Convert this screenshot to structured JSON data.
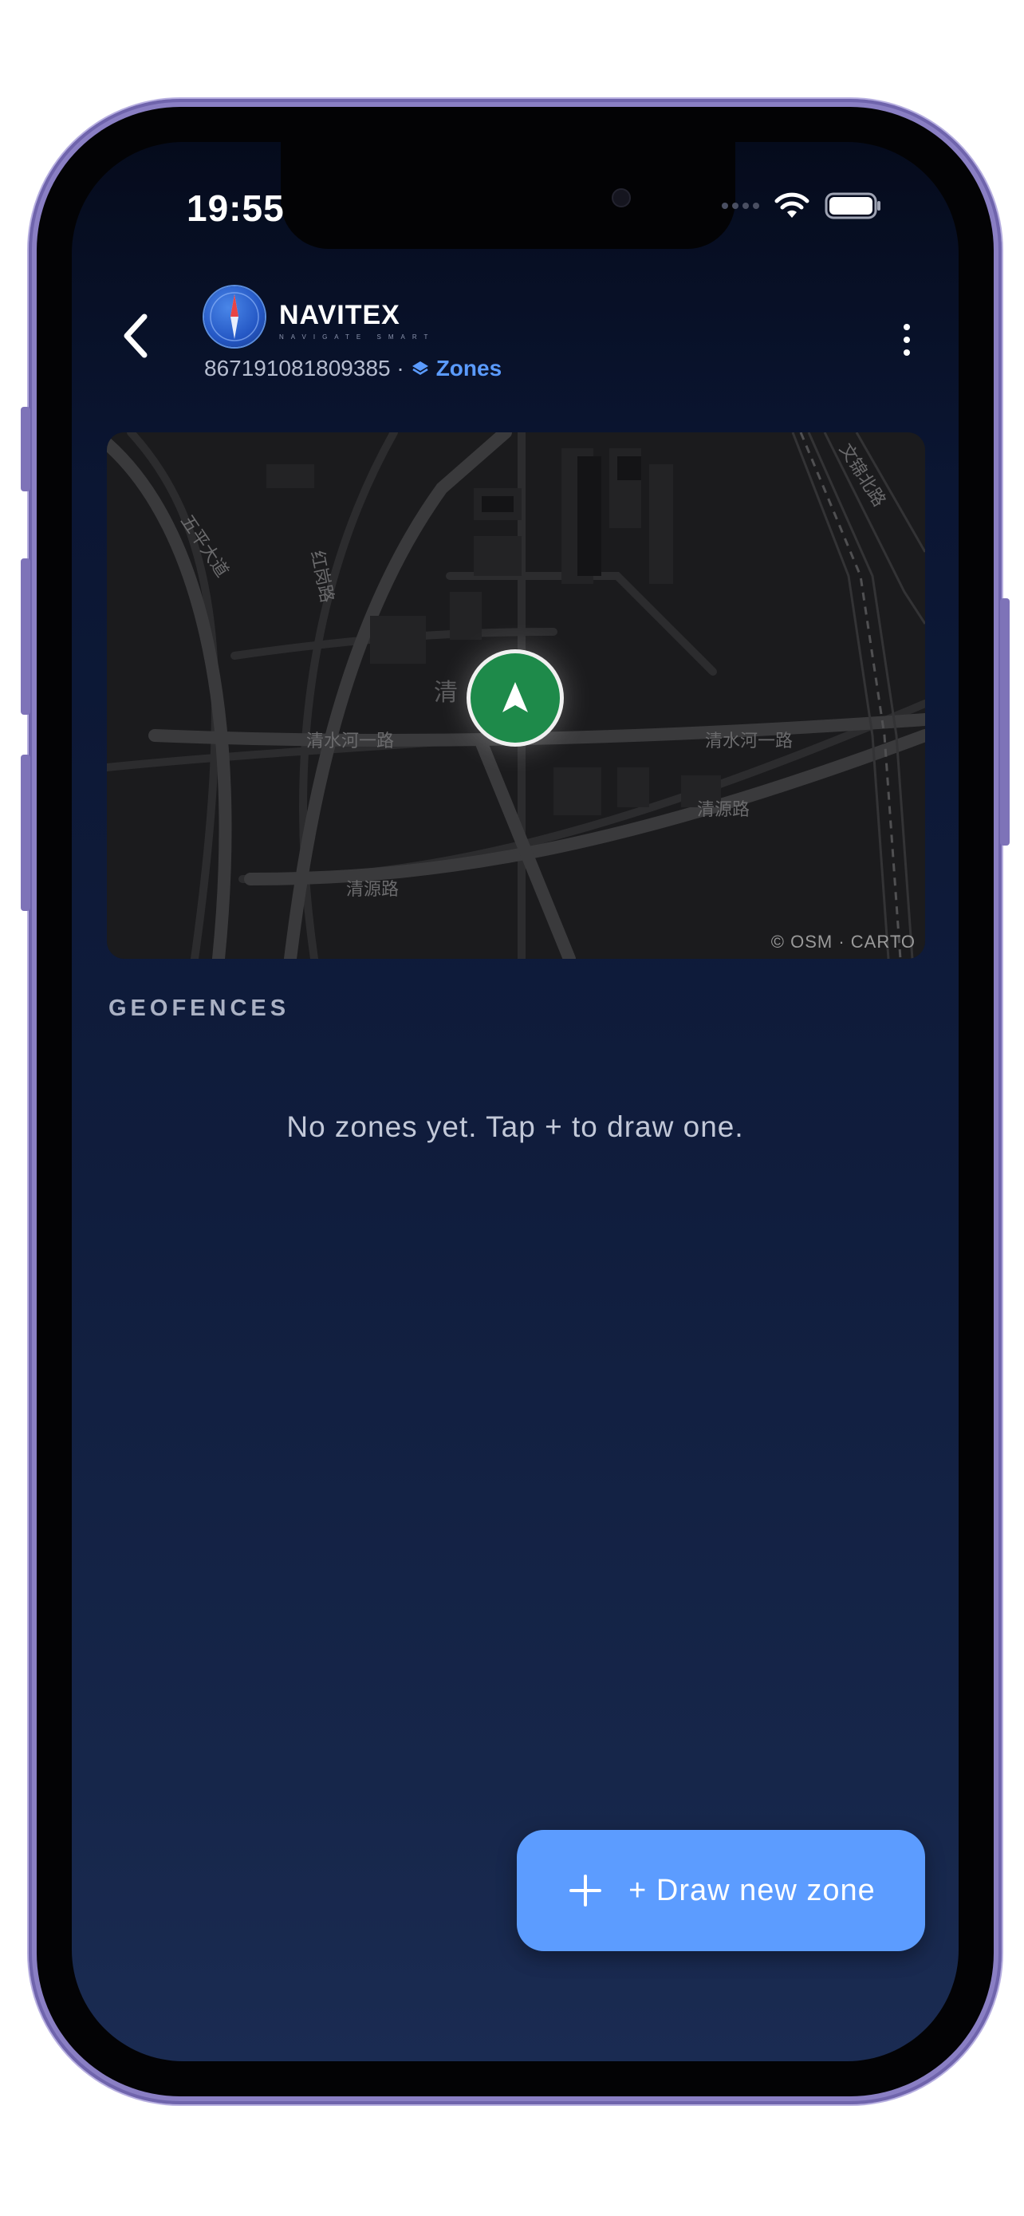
{
  "status_bar": {
    "time": "19:55",
    "icons": [
      "signal-dots",
      "wifi-icon",
      "battery-icon"
    ]
  },
  "header": {
    "back_icon": "chevron-left-icon",
    "logo_icon": "compass-icon",
    "brand": "NAVITEX",
    "brand_tagline": "NAVIGATE SMART",
    "device_id": "867191081809385 ·",
    "section_icon": "layers-icon",
    "section": "Zones",
    "menu_icon": "more-vertical-icon"
  },
  "map": {
    "attribution": "© OSM · CARTO",
    "street_labels": [
      "清水河一路",
      "清水河一路",
      "清源路",
      "清源路",
      "红岗路",
      "五平大道",
      "文锦北路",
      "清"
    ],
    "marker_icon": "navigation-arrow-icon",
    "marker_color": "#1e8a4a"
  },
  "geofences": {
    "heading": "GEOFENCES",
    "empty_message": "No zones yet. Tap + to draw one."
  },
  "fab": {
    "label": "+ Draw new zone",
    "icon": "plus-icon",
    "color": "#5c9cff"
  },
  "theme": {
    "accent": "#5b9bff",
    "background": "#0b1633"
  }
}
